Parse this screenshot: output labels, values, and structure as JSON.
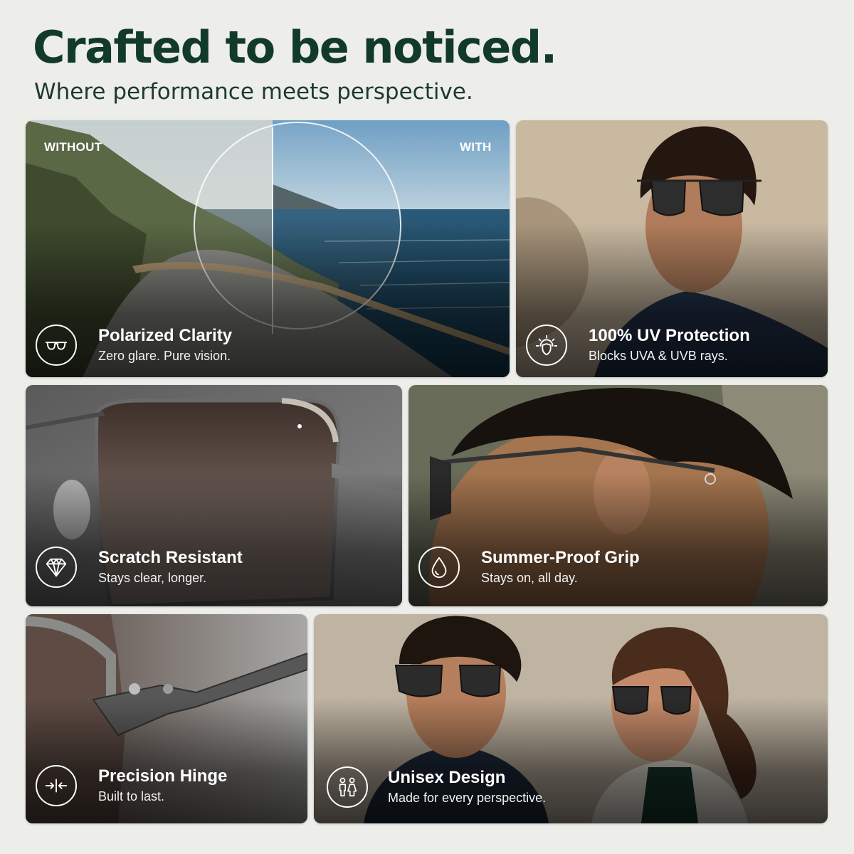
{
  "header": {
    "title": "Crafted to be noticed.",
    "subtitle": "Where performance meets perspective."
  },
  "comparison": {
    "left_label": "WITHOUT",
    "right_label": "WITH"
  },
  "features": [
    {
      "title": "Polarized Clarity",
      "desc": "Zero glare. Pure vision.",
      "icon": "sunglasses-icon"
    },
    {
      "title": "100% UV Protection",
      "desc": "Blocks UVA & UVB rays.",
      "icon": "sun-shield-icon"
    },
    {
      "title": "Scratch Resistant",
      "desc": "Stays clear, longer.",
      "icon": "diamond-icon"
    },
    {
      "title": "Summer-Proof Grip",
      "desc": "Stays on, all day.",
      "icon": "droplet-icon"
    },
    {
      "title": "Precision Hinge",
      "desc": "Built to last.",
      "icon": "hinge-arrows-icon"
    },
    {
      "title": "Unisex Design",
      "desc": "Made for every perspective.",
      "icon": "man-woman-icon"
    }
  ],
  "colors": {
    "background": "#ededea",
    "headline": "#123a2b",
    "card_text": "#ffffff"
  }
}
